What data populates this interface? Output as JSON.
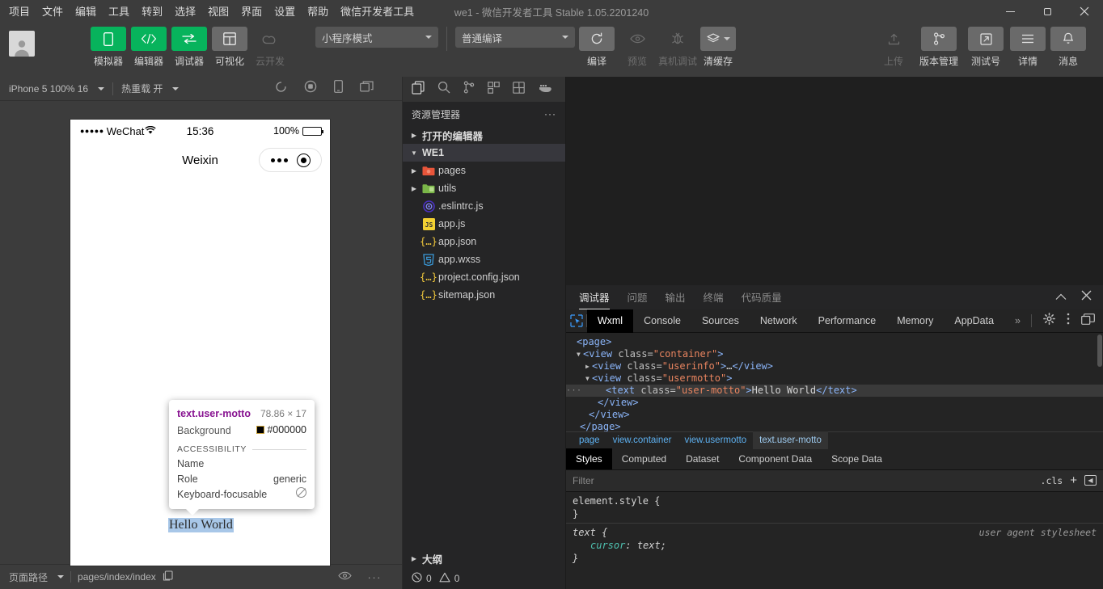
{
  "window": {
    "title": "we1  -  微信开发者工具 Stable 1.05.2201240",
    "minimize": "–",
    "maximize": "□",
    "close": "×"
  },
  "menu": [
    "项目",
    "文件",
    "编辑",
    "工具",
    "转到",
    "选择",
    "视图",
    "界面",
    "设置",
    "帮助",
    "微信开发者工具"
  ],
  "toolbar": {
    "buttons": [
      {
        "label": "模拟器",
        "icon": "phone-icon",
        "style": "green",
        "disabled": false
      },
      {
        "label": "编辑器",
        "icon": "code-icon",
        "style": "green",
        "disabled": false
      },
      {
        "label": "调试器",
        "icon": "debugger-icon",
        "style": "green",
        "disabled": false
      },
      {
        "label": "可视化",
        "icon": "layout-icon",
        "style": "grey",
        "disabled": false
      },
      {
        "label": "云开发",
        "icon": "cloud-icon",
        "style": "flat",
        "disabled": true
      }
    ],
    "mode_select": "小程序模式",
    "compile_select": "普通编译",
    "actions": [
      {
        "label": "编译",
        "icon": "refresh-icon",
        "disabled": false
      },
      {
        "label": "预览",
        "icon": "eye-icon",
        "disabled": true
      },
      {
        "label": "真机调试",
        "icon": "bug-icon",
        "disabled": true
      },
      {
        "label": "清缓存",
        "icon": "layers-icon",
        "disabled": false
      }
    ],
    "right_actions": [
      {
        "label": "上传",
        "icon": "upload-icon",
        "disabled": true
      },
      {
        "label": "版本管理",
        "icon": "branch-icon",
        "disabled": false
      },
      {
        "label": "测试号",
        "icon": "external-link-icon",
        "disabled": false
      },
      {
        "label": "详情",
        "icon": "hamburger-icon",
        "disabled": false
      },
      {
        "label": "消息",
        "icon": "bell-icon",
        "disabled": false
      }
    ]
  },
  "simulator": {
    "device_select": "iPhone 5 100% 16",
    "hot_reload": "热重载 开",
    "toolbar_icons": [
      "rotate-icon",
      "record-icon",
      "device-icon",
      "window-icon"
    ],
    "phone": {
      "status_carrier": "WeChat",
      "status_dots": "●●●●●",
      "time": "15:36",
      "battery_pct": "100%",
      "nav_title": "Weixin"
    },
    "page_text": "Hello World",
    "inspector_tip": {
      "selector": "text.user-motto",
      "dimensions": "78.86 × 17",
      "background_label": "Background",
      "background_value": "#000000",
      "section": "ACCESSIBILITY",
      "rows": [
        {
          "key": "Name",
          "value": ""
        },
        {
          "key": "Role",
          "value": "generic"
        },
        {
          "key": "Keyboard-focusable",
          "value": "no-icon"
        }
      ]
    },
    "status_bar": {
      "path_label": "页面路径",
      "path_value": "pages/index/index",
      "copy_icon": "copy-icon",
      "eye_icon": "eye-icon",
      "more_icon": "more-icon"
    }
  },
  "explorer": {
    "activity_icons": [
      "files-icon",
      "search-icon",
      "source-control-icon",
      "extensions-icon",
      "miniprogram-icon",
      "docker-icon"
    ],
    "title": "资源管理器",
    "more": "···",
    "open_editors": "打开的编辑器",
    "project": "WE1",
    "files": [
      {
        "name": "pages",
        "type": "folder",
        "icon": "folder-red-icon",
        "expandable": true
      },
      {
        "name": "utils",
        "type": "folder",
        "icon": "folder-green-icon",
        "expandable": true
      },
      {
        "name": ".eslintrc.js",
        "type": "file",
        "icon": "eslint-icon",
        "expandable": false
      },
      {
        "name": "app.js",
        "type": "file",
        "icon": "js-icon",
        "expandable": false
      },
      {
        "name": "app.json",
        "type": "file",
        "icon": "json-icon",
        "expandable": false
      },
      {
        "name": "app.wxss",
        "type": "file",
        "icon": "wxss-icon",
        "expandable": false
      },
      {
        "name": "project.config.json",
        "type": "file",
        "icon": "json-icon",
        "expandable": false
      },
      {
        "name": "sitemap.json",
        "type": "file",
        "icon": "json-icon",
        "expandable": false
      }
    ],
    "outline": "大纲",
    "errors": "0",
    "warnings": "0"
  },
  "devtools": {
    "top_tabs": [
      {
        "label": "调试器",
        "active": true
      },
      {
        "label": "问题",
        "active": false
      },
      {
        "label": "输出",
        "active": false
      },
      {
        "label": "终端",
        "active": false
      },
      {
        "label": "代码质量",
        "active": false
      }
    ],
    "collapse_icon": "chevron-up-icon",
    "close_icon": "close-icon",
    "panel_tabs": [
      {
        "label": "Wxml",
        "active": true
      },
      {
        "label": "Console",
        "active": false
      },
      {
        "label": "Sources",
        "active": false
      },
      {
        "label": "Network",
        "active": false
      },
      {
        "label": "Performance",
        "active": false
      },
      {
        "label": "Memory",
        "active": false
      },
      {
        "label": "AppData",
        "active": false
      }
    ],
    "more_tabs": "»",
    "panel_right_icons": [
      "gear-icon",
      "kebab-icon",
      "dock-icon"
    ],
    "wxml_tree": [
      {
        "indent": 0,
        "arrow": "",
        "parts": [
          {
            "t": "tag",
            "v": "<page>"
          }
        ],
        "highlight": false
      },
      {
        "indent": 1,
        "arrow": "▼",
        "parts": [
          {
            "t": "tag",
            "v": "<view "
          },
          {
            "t": "attr",
            "v": "class="
          },
          {
            "t": "val",
            "v": "\"container\""
          },
          {
            "t": "tag",
            "v": ">"
          }
        ],
        "highlight": false
      },
      {
        "indent": 2,
        "arrow": "▶",
        "parts": [
          {
            "t": "tag",
            "v": "<view "
          },
          {
            "t": "attr",
            "v": "class="
          },
          {
            "t": "val",
            "v": "\"userinfo\""
          },
          {
            "t": "tag",
            "v": ">"
          },
          {
            "t": "text",
            "v": "…"
          },
          {
            "t": "tag",
            "v": "</view>"
          }
        ],
        "highlight": false
      },
      {
        "indent": 2,
        "arrow": "▼",
        "parts": [
          {
            "t": "tag",
            "v": "<view "
          },
          {
            "t": "attr",
            "v": "class="
          },
          {
            "t": "val",
            "v": "\"usermotto\""
          },
          {
            "t": "tag",
            "v": ">"
          }
        ],
        "highlight": false
      },
      {
        "indent": 4,
        "arrow": "",
        "parts": [
          {
            "t": "tag",
            "v": "<text "
          },
          {
            "t": "attr",
            "v": "class="
          },
          {
            "t": "val",
            "v": "\"user-motto\""
          },
          {
            "t": "tag",
            "v": ">"
          },
          {
            "t": "text",
            "v": "Hello World"
          },
          {
            "t": "tag",
            "v": "</text>"
          }
        ],
        "highlight": true
      },
      {
        "indent": 3,
        "arrow": "",
        "parts": [
          {
            "t": "tag",
            "v": "</view>"
          }
        ],
        "highlight": false
      },
      {
        "indent": 2,
        "arrow": "",
        "parts": [
          {
            "t": "tag",
            "v": "</view>"
          }
        ],
        "highlight": false
      },
      {
        "indent": 1,
        "arrow": "",
        "parts": [
          {
            "t": "tag",
            "v": "</page>"
          }
        ],
        "highlight": false
      }
    ],
    "breadcrumbs": [
      {
        "label": "page",
        "active": false
      },
      {
        "label": "view.container",
        "active": false
      },
      {
        "label": "view.usermotto",
        "active": false
      },
      {
        "label": "text.user-motto",
        "active": true
      }
    ],
    "style_tabs": [
      {
        "label": "Styles",
        "active": true
      },
      {
        "label": "Computed",
        "active": false
      },
      {
        "label": "Dataset",
        "active": false
      },
      {
        "label": "Component Data",
        "active": false
      },
      {
        "label": "Scope Data",
        "active": false
      }
    ],
    "filter_placeholder": "Filter",
    "filter_value": "",
    "cls_button": ".cls",
    "add_rule_button": "+",
    "toggle_sidebar_icon": "panel-toggle-icon",
    "css_rules": [
      {
        "selector": "element.style {",
        "origin": "",
        "decls": [],
        "close": "}",
        "italic": false
      },
      {
        "selector": "text {",
        "origin": "user agent stylesheet",
        "decls": [
          {
            "prop": "cursor",
            "value": " text;"
          }
        ],
        "close": "}",
        "italic": true
      }
    ]
  }
}
